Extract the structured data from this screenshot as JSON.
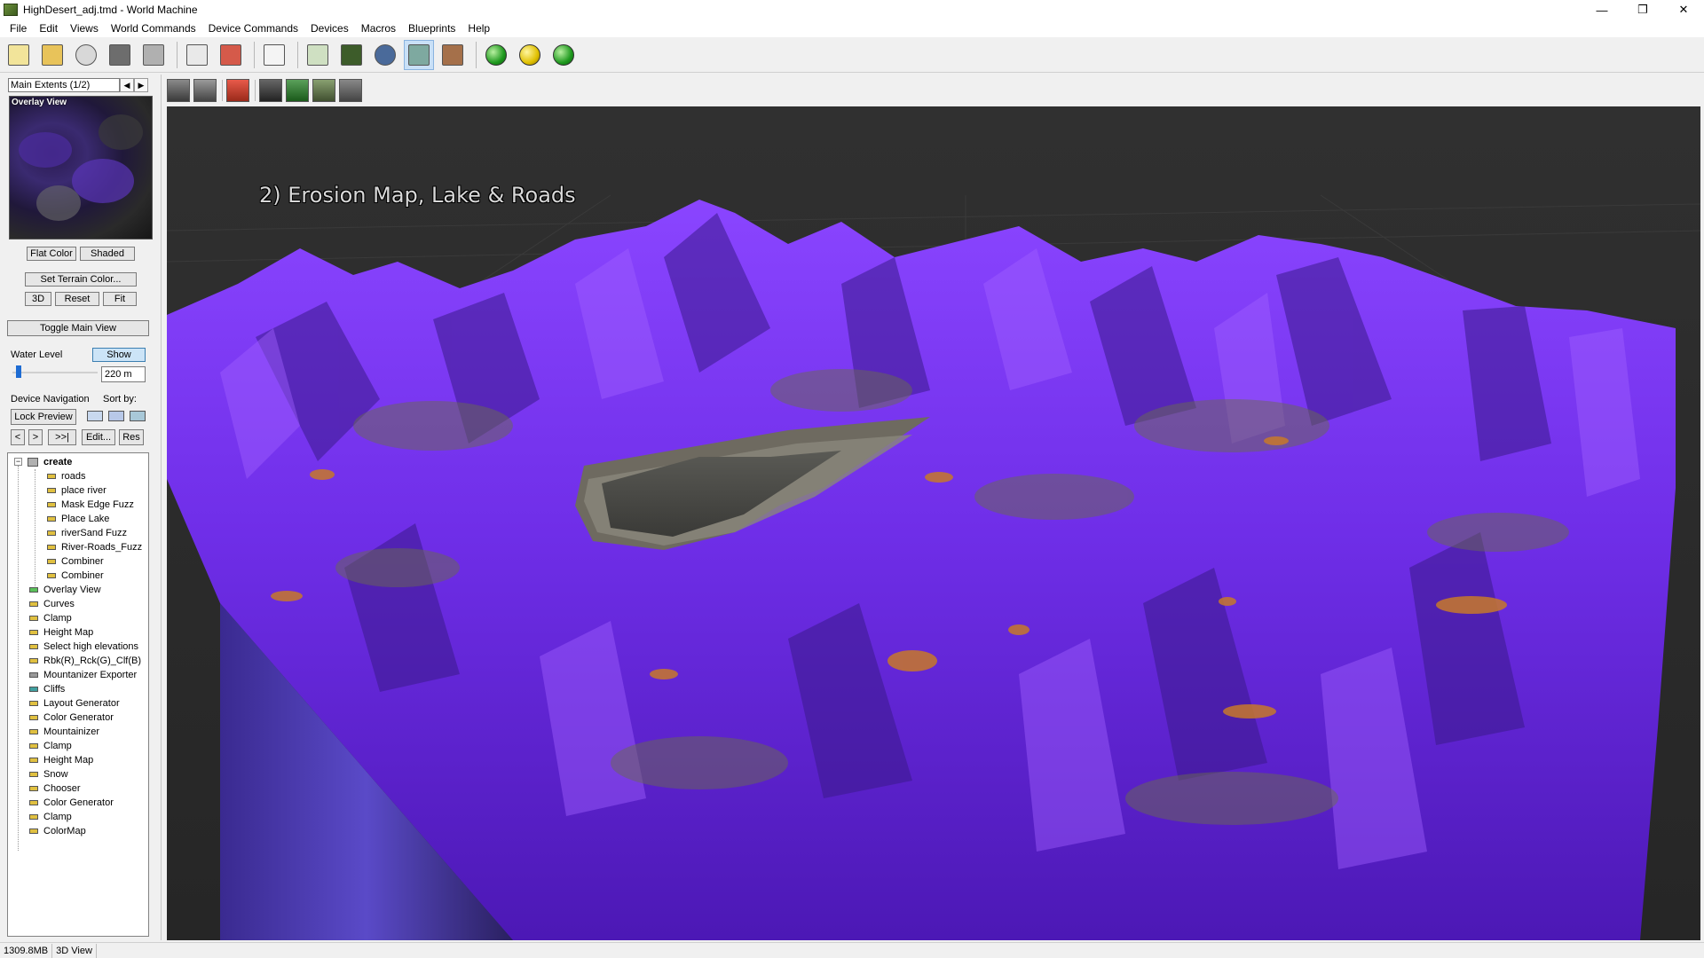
{
  "window": {
    "title": "HighDesert_adj.tmd - World Machine"
  },
  "menubar": {
    "items": [
      "File",
      "Edit",
      "Views",
      "World Commands",
      "Device Commands",
      "Devices",
      "Macros",
      "Blueprints",
      "Help"
    ]
  },
  "left": {
    "extents_value": "Main Extents (1/2)",
    "overlay_label": "Overlay View",
    "flat_color": "Flat Color",
    "shaded": "Shaded",
    "set_terrain_color": "Set Terrain Color...",
    "btn_3d": "3D",
    "btn_reset": "Reset",
    "btn_fit": "Fit",
    "toggle_main_view": "Toggle Main View",
    "water_level_label": "Water Level",
    "show": "Show",
    "water_level_value": "220 m",
    "water_level_fraction": 0.04,
    "device_navigation": "Device Navigation",
    "sort_by": "Sort by:",
    "lock_preview": "Lock Preview",
    "nav_back": "<",
    "nav_forward": ">",
    "nav_end": ">>|",
    "edit": "Edit...",
    "res": "Res"
  },
  "tree": {
    "group": "create",
    "children": [
      "roads",
      "place river",
      "Mask Edge Fuzz",
      "Place Lake",
      "riverSand Fuzz",
      "River-Roads_Fuzz",
      "Combiner",
      "Combiner"
    ],
    "items": [
      "Overlay View",
      "Curves",
      "Clamp",
      "Height Map",
      "Select high elevations",
      "Rbk(R)_Rck(G)_Clf(B)",
      "Mountanizer Exporter",
      "Cliffs",
      "Layout Generator",
      "Color Generator",
      "Mountainizer",
      "Clamp",
      "Height Map",
      "Snow",
      "Chooser",
      "Color Generator",
      "Clamp",
      "ColorMap"
    ]
  },
  "viewport": {
    "title": "2) Erosion Map, Lake & Roads"
  },
  "status": {
    "memory": "1309.8MB",
    "view": "3D View"
  },
  "colors": {
    "terrain_purple": "#7a2ff0",
    "lake": "#4b4b48",
    "viewport_bg": "#2c2c2c",
    "accent_blue": "#1e6cd3"
  }
}
